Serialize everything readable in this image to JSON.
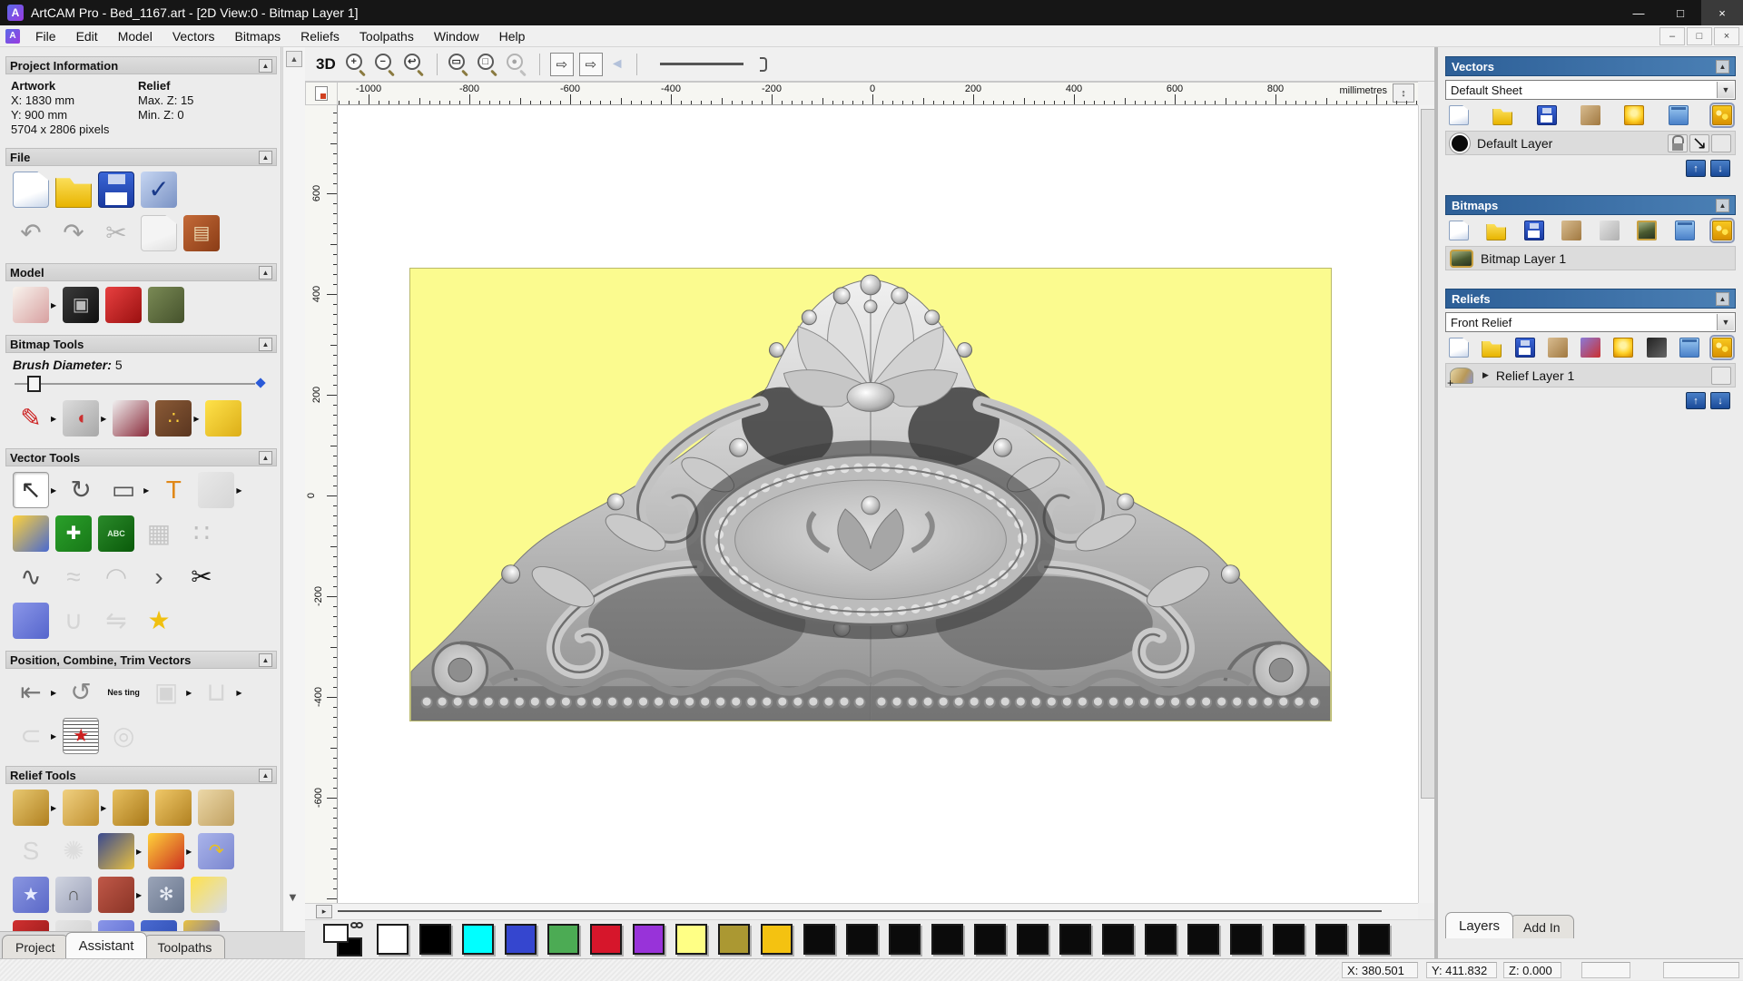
{
  "window": {
    "title": "ArtCAM Pro - Bed_1167.art - [2D View:0 - Bitmap Layer 1]",
    "app_icon_letter": "A",
    "controls": [
      {
        "name": "minimize-button",
        "glyph": "—"
      },
      {
        "name": "maximize-button",
        "glyph": "□"
      },
      {
        "name": "close-button",
        "glyph": "×"
      }
    ]
  },
  "menu": {
    "items": [
      "File",
      "Edit",
      "Model",
      "Vectors",
      "Bitmaps",
      "Reliefs",
      "Toolpaths",
      "Window",
      "Help"
    ],
    "child_controls": [
      {
        "name": "child-minimize-button",
        "glyph": "–"
      },
      {
        "name": "child-restore-button",
        "glyph": "□"
      },
      {
        "name": "child-close-button",
        "glyph": "×"
      }
    ]
  },
  "left_panel": {
    "project_info": {
      "title": "Project Information",
      "artwork_label": "Artwork",
      "relief_label": "Relief",
      "x": "X: 1830 mm",
      "y": "Y: 900 mm",
      "pixels": "5704 x 2806 pixels",
      "max_z": "Max. Z: 15",
      "min_z": "Min. Z: 0"
    },
    "file": {
      "title": "File",
      "row1": [
        {
          "name": "new-model-icon",
          "cls": "pg"
        },
        {
          "name": "open-model-icon",
          "cls": "fld"
        },
        {
          "name": "save-model-icon",
          "cls": "flp"
        },
        {
          "name": "options-icon",
          "c": [
            "#c6d6f2",
            "#7a92c4"
          ],
          "g": "✓",
          "gc": "#1a3a8a",
          "big": true
        }
      ],
      "row2": [
        {
          "name": "undo-icon",
          "g": "↶",
          "gc": "#9a9a9a",
          "big": true
        },
        {
          "name": "redo-icon",
          "g": "↷",
          "gc": "#9a9a9a",
          "big": true
        },
        {
          "name": "cut-icon",
          "g": "✂",
          "gc": "#777",
          "big": true,
          "dis": true
        },
        {
          "name": "copy-icon",
          "cls": "pg",
          "dis": true
        },
        {
          "name": "paste-icon",
          "c": [
            "#c46a38",
            "#8a3c16"
          ],
          "g": "▤",
          "gc": "#ecd9b0"
        }
      ]
    },
    "model": {
      "title": "Model",
      "row1": [
        {
          "name": "set-model-size-icon",
          "c": [
            "#f8f4ee",
            "#d8a0a0"
          ],
          "fl": true
        },
        {
          "name": "adjust-model-icon",
          "c": [
            "#3a3a3a",
            "#101010"
          ],
          "g": "▣",
          "gc": "#bbbbbb"
        },
        {
          "name": "model-lighting-icon",
          "c": [
            "#e84040",
            "#9a1010"
          ]
        },
        {
          "name": "load-reference-image-icon",
          "c": [
            "#7a8a55",
            "#45522c"
          ]
        }
      ]
    },
    "bitmap_tools": {
      "title": "Bitmap Tools",
      "brush_label": "Brush Diameter:",
      "brush_value": "5",
      "row1": [
        {
          "name": "paint-brush-icon",
          "g": "✎",
          "gc": "#cc2020",
          "big": true,
          "fl": true
        },
        {
          "name": "flood-fill-icon",
          "c": [
            "#dcdcdc",
            "#a8a8a8"
          ],
          "g": "◖",
          "gc": "#cc3030",
          "fl": true
        },
        {
          "name": "colour-picker-icon",
          "c": [
            "#f0f0f0",
            "#8a2a3a"
          ]
        },
        {
          "name": "palette-icon",
          "c": [
            "#8a5a36",
            "#5a3620"
          ],
          "g": "∴",
          "gc": "#ffd23a",
          "fl": true
        },
        {
          "name": "magic-select-icon",
          "c": [
            "#ffe24a",
            "#dcae18"
          ]
        }
      ]
    },
    "vector_tools": {
      "title": "Vector Tools",
      "row1": [
        {
          "name": "select-vectors-icon",
          "g": "↖",
          "gc": "#333333",
          "big": true,
          "pressed": true,
          "fl": true
        },
        {
          "name": "transform-vectors-icon",
          "g": "↻",
          "gc": "#555555",
          "big": true
        },
        {
          "name": "create-rectangle-icon",
          "g": "▭",
          "gc": "#555555",
          "big": true,
          "fl": true
        },
        {
          "name": "create-text-icon",
          "g": "T",
          "gc": "#e08818",
          "big": true
        },
        {
          "name": "envelope-distort-icon",
          "c": [
            "#e4e4e4",
            "#bcbcbc"
          ],
          "dis": true,
          "fl": true
        }
      ],
      "row2": [
        {
          "name": "measure-icon",
          "c": [
            "#ffd23a",
            "#4a6ad0"
          ]
        },
        {
          "name": "node-editing-icon",
          "c": [
            "#2aa02a",
            "#187818"
          ],
          "g": "✚",
          "gc": "#ffffff"
        },
        {
          "name": "create-text-abc-icon",
          "c": [
            "#2a8a2a",
            "#0a5a0a"
          ],
          "txt": "ABC",
          "txtc": "#d8f0d8"
        },
        {
          "name": "distort-vectors-icon",
          "g": "▦",
          "gc": "#999999",
          "big": true,
          "dis": true
        },
        {
          "name": "paste-copies-icon",
          "g": "∷",
          "gc": "#888888",
          "big": true,
          "dis": true
        }
      ],
      "row3": [
        {
          "name": "create-polyline-icon",
          "g": "∿",
          "gc": "#555555",
          "big": true
        },
        {
          "name": "freehand-sketch-icon",
          "g": "≈",
          "gc": "#aaaaaa",
          "big": true,
          "dis": true
        },
        {
          "name": "create-arc-icon",
          "g": "◠",
          "gc": "#9a9a9a",
          "big": true,
          "dis": true
        },
        {
          "name": "fillet-corner-icon",
          "g": "›",
          "gc": "#555555",
          "big": true
        },
        {
          "name": "trim-vectors-icon",
          "g": "✂",
          "gc": "#181818",
          "big": true
        }
      ],
      "row4": [
        {
          "name": "create-dome-icon",
          "c": [
            "#8a96e8",
            "#5565cc"
          ]
        },
        {
          "name": "join-vectors-icon",
          "g": "∪",
          "gc": "#bbbbbb",
          "big": true,
          "dis": true
        },
        {
          "name": "mirror-vectors-icon",
          "g": "⇋",
          "gc": "#bbbbbb",
          "big": true,
          "dis": true
        },
        {
          "name": "create-star-icon",
          "g": "★",
          "gc": "#f0c010",
          "big": true
        }
      ]
    },
    "position_tools": {
      "title": "Position, Combine, Trim Vectors",
      "row1": [
        {
          "name": "align-vectors-icon",
          "g": "⇤",
          "gc": "#777777",
          "big": true,
          "fl": true
        },
        {
          "name": "text-on-curve-icon",
          "g": "↺",
          "gc": "#888888",
          "big": true
        },
        {
          "name": "nesting-icon",
          "txt": "Nes ting",
          "txtc": "#111111"
        },
        {
          "name": "block-copy-icon",
          "g": "▣",
          "gc": "#bbbbbb",
          "big": true,
          "dis": true,
          "fl": true
        },
        {
          "name": "weld-vectors-icon",
          "g": "⊔",
          "gc": "#bbbbbb",
          "big": true,
          "dis": true,
          "fl": true
        }
      ],
      "row2": [
        {
          "name": "close-join-vectors-icon",
          "g": "⊂",
          "gc": "#bbbbbb",
          "big": true,
          "dis": true,
          "fl": true
        },
        {
          "name": "vector-texture-icon",
          "cls": "vtex",
          "g": "★",
          "gc": "#cc2020"
        },
        {
          "name": "spiral-icon",
          "g": "◎",
          "gc": "#bbbbbb",
          "big": true,
          "dis": true
        }
      ]
    },
    "relief_tools": {
      "title": "Relief Tools",
      "row1": [
        {
          "name": "calculate-relief-icon",
          "c": [
            "#e8c870",
            "#b08020"
          ],
          "fl": true
        },
        {
          "name": "create-shape-icon",
          "c": [
            "#f0d080",
            "#c09030"
          ],
          "fl": true
        },
        {
          "name": "fountain-add-icon",
          "c": [
            "#e8c060",
            "#a87818"
          ]
        },
        {
          "name": "fountain-subtract-icon",
          "c": [
            "#f0c868",
            "#b08020"
          ]
        },
        {
          "name": "fountain-merge-icon",
          "c": [
            "#ecd8a8",
            "#c0a060"
          ]
        }
      ],
      "row2": [
        {
          "name": "isoform-icon",
          "g": "S",
          "gc": "#bbbbbb",
          "big": true,
          "dis": true
        },
        {
          "name": "weave-wizard-icon",
          "g": "✺",
          "gc": "#cccccc",
          "big": true,
          "dis": true
        },
        {
          "name": "emboss-wizard-icon",
          "c": [
            "#3a4a90",
            "#e8c040"
          ],
          "fl": true
        },
        {
          "name": "offset-relief-icon",
          "c": [
            "#ffd23a",
            "#cc3020"
          ],
          "fl": true
        },
        {
          "name": "relief-wrap-icon",
          "c": [
            "#aab4ea",
            "#7a86d0"
          ],
          "g": "↷",
          "gc": "#e8c020"
        }
      ],
      "row3": [
        {
          "name": "shape-editor-icon",
          "c": [
            "#8a96e0",
            "#5a68c8"
          ],
          "g": "★",
          "gc": "#e8ecff"
        },
        {
          "name": "constrain-relief-icon",
          "c": [
            "#d0d4e0",
            "#9aa0b8"
          ],
          "g": "∩",
          "gc": "#555555"
        },
        {
          "name": "two-rail-sweep-icon",
          "c": [
            "#c05848",
            "#8a3426"
          ],
          "fl": true
        },
        {
          "name": "texture-relief-icon",
          "c": [
            "#9aa4b8",
            "#68758c"
          ],
          "g": "✻",
          "gc": "#e8ecf4"
        },
        {
          "name": "relief-layers-icon",
          "c": [
            "#ffe24a",
            "#d8dce8"
          ]
        }
      ],
      "row4": [
        {
          "name": "interactive-sculpting-icon",
          "c": [
            "#d03030",
            "#901818"
          ]
        },
        {
          "name": "relief-basket-icon",
          "c": [
            "#dddddd",
            "#aaaaaa"
          ],
          "dis": true
        },
        {
          "name": "add-dome-relief-icon",
          "c": [
            "#8a96e8",
            "#5868d0"
          ]
        },
        {
          "name": "texture-ball-icon",
          "c": [
            "#4a6ad0",
            "#2a4ab0"
          ]
        },
        {
          "name": "relief-extra-icon",
          "c": [
            "#e8c040",
            "#5868d0"
          ]
        }
      ]
    },
    "tabs": [
      {
        "label": "Project"
      },
      {
        "label": "Assistant",
        "active": true
      },
      {
        "label": "Toolpaths"
      }
    ]
  },
  "canvas": {
    "toolbar": [
      {
        "t": "txt",
        "name": "view-3d-button",
        "label": "3D"
      },
      {
        "t": "mag",
        "name": "zoom-in-icon",
        "sub": "+"
      },
      {
        "t": "mag",
        "name": "zoom-out-icon",
        "sub": "−"
      },
      {
        "t": "mag",
        "name": "zoom-previous-icon",
        "sub": "↩"
      },
      {
        "t": "sep"
      },
      {
        "t": "mag",
        "name": "zoom-fit-icon",
        "sub": "▭"
      },
      {
        "t": "mag",
        "name": "zoom-box-icon",
        "sub": "□"
      },
      {
        "t": "mag",
        "name": "zoom-selection-icon",
        "sub": "●",
        "dis": true
      },
      {
        "t": "sep"
      },
      {
        "t": "box",
        "name": "bitmap-to-relief-icon",
        "g": "⇨"
      },
      {
        "t": "box",
        "name": "relief-to-bitmap-icon",
        "g": "⇨"
      },
      {
        "t": "glyph",
        "name": "preview-relief-icon",
        "g": "◄",
        "gc": "#6a8ac0",
        "dis": true
      },
      {
        "t": "sep"
      },
      {
        "t": "line",
        "name": "line-width-preview"
      }
    ],
    "rulers": {
      "unit": "millimetres",
      "top": {
        "labels": [
          "-1000",
          "-800",
          "-600",
          "-400",
          "-200",
          "0",
          "200",
          "400",
          "600",
          "800"
        ],
        "start": 34,
        "step": 111,
        "minor": 11.1
      },
      "left": {
        "labels": [
          "600",
          "400",
          "200",
          "0",
          "-200",
          "-400",
          "-600"
        ],
        "start": 97,
        "step": 111,
        "minor": 11.1
      }
    }
  },
  "palette": {
    "primary": "#ffffff",
    "secondary": "#000000",
    "swatches": [
      "#ffffff",
      "#000000",
      "#00ffff",
      "#3546cf",
      "#4cab54",
      "#d6162b",
      "#9833d9",
      "#ffff85",
      "#ab9832",
      "#f4c211",
      "#0b0b0b",
      "#0b0b0b",
      "#0b0b0b",
      "#0b0b0b",
      "#0b0b0b",
      "#0b0b0b",
      "#0b0b0b",
      "#0b0b0b",
      "#0b0b0b",
      "#0b0b0b",
      "#0b0b0b",
      "#0b0b0b",
      "#0b0b0b",
      "#0b0b0b"
    ]
  },
  "right_panel": {
    "vectors": {
      "title": "Vectors",
      "sheet_value": "Default Sheet",
      "toolbar": [
        {
          "name": "new-vector-layer-icon",
          "cls": "pg"
        },
        {
          "name": "open-vector-layer-icon",
          "cls": "fld"
        },
        {
          "name": "save-vector-layer-icon",
          "cls": "flp"
        },
        {
          "name": "merge-vector-layers-icon",
          "c": [
            "#d8bc90",
            "#a07840"
          ]
        },
        {
          "name": "toggle-layer-visibility-icon",
          "cls": "blb"
        },
        {
          "name": "delete-vector-layer-icon",
          "cls": "trash"
        },
        {
          "name": "all-layers-on-icon",
          "cls": "blbs",
          "sel": true
        }
      ],
      "layer": {
        "name": "Default Layer"
      },
      "layer_icons": [
        {
          "name": "lock-layer-icon",
          "cls": "lockic"
        },
        {
          "name": "snap-to-layer-icon",
          "cls": "snapic",
          "g": "↘",
          "gc": "#111111"
        },
        {
          "name": "layer-bulb-icon",
          "cls": "blb"
        }
      ]
    },
    "bitmaps": {
      "title": "Bitmaps",
      "toolbar": [
        {
          "name": "new-bitmap-layer-icon",
          "cls": "pg"
        },
        {
          "name": "open-bitmap-layer-icon",
          "cls": "fld"
        },
        {
          "name": "save-bitmap-layer-icon",
          "cls": "flp"
        },
        {
          "name": "merge-bitmap-layers-icon",
          "c": [
            "#d8bc90",
            "#a07840"
          ]
        },
        {
          "name": "clear-bitmap-layer-icon",
          "c": [
            "#e4e4e4",
            "#b0b0b0"
          ]
        },
        {
          "name": "bitmap-preview-icon",
          "cls": "mona"
        },
        {
          "name": "delete-bitmap-layer-icon",
          "cls": "trash"
        },
        {
          "name": "all-bitmaps-on-icon",
          "cls": "blbs",
          "sel": true
        }
      ],
      "layer": {
        "name": "Bitmap Layer 1"
      }
    },
    "reliefs": {
      "title": "Reliefs",
      "relief_value": "Front Relief",
      "toolbar": [
        {
          "name": "new-relief-layer-icon",
          "cls": "pg"
        },
        {
          "name": "open-relief-layer-icon",
          "cls": "fld"
        },
        {
          "name": "save-relief-layer-icon",
          "cls": "flp"
        },
        {
          "name": "merge-relief-layers-icon",
          "c": [
            "#d8bc90",
            "#a07840"
          ]
        },
        {
          "name": "stack-reliefs-icon",
          "c": [
            "#8a7ad8",
            "#cc3030"
          ]
        },
        {
          "name": "relief-bulb-page-icon",
          "cls": "blb"
        },
        {
          "name": "relief-greyscale-preview-icon",
          "c": [
            "#222222",
            "#666666"
          ]
        },
        {
          "name": "delete-relief-layer-icon",
          "cls": "trash"
        },
        {
          "name": "all-reliefs-on-icon",
          "cls": "blbs",
          "sel": true
        }
      ],
      "layer": {
        "name": "Relief Layer 1"
      },
      "layer_icons": [
        {
          "name": "relief-layer-bulb-icon",
          "cls": "blb"
        }
      ]
    },
    "tabs": [
      {
        "label": "Layers",
        "active": true
      },
      {
        "label": "Add In"
      }
    ]
  },
  "status_bar": {
    "cells": [
      "X: 380.501",
      "Y: 411.832",
      "Z: 0.000",
      "",
      ""
    ]
  }
}
